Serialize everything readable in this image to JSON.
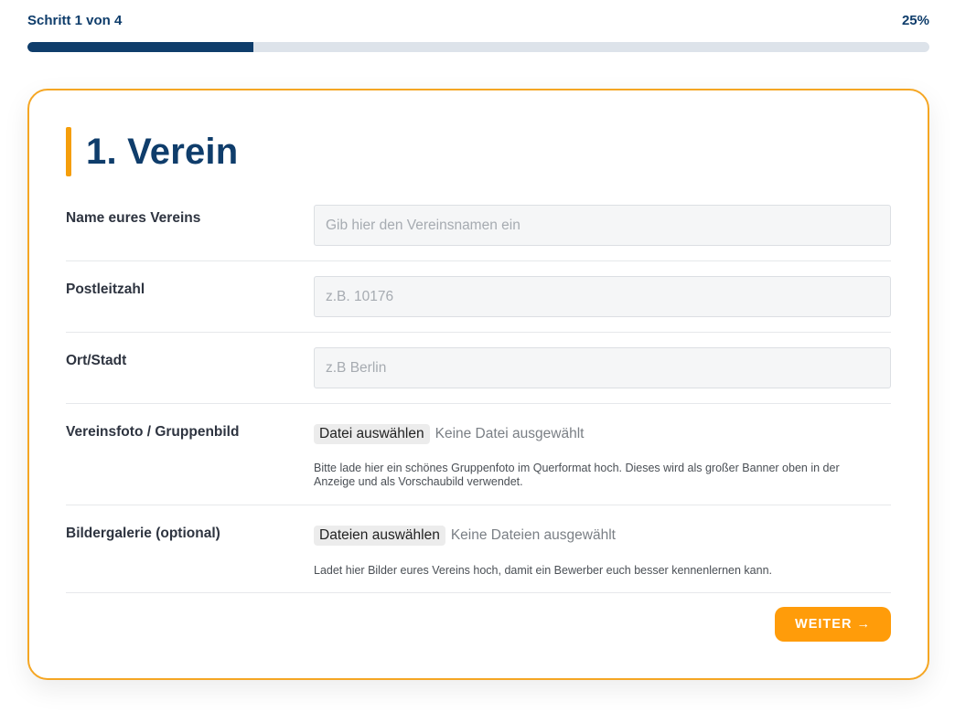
{
  "progress": {
    "step_label": "Schritt 1 von 4",
    "percent_label": "25%",
    "fraction": 0.25,
    "fill_color": "#0f3d6b",
    "track_color": "#dde3ea"
  },
  "section": {
    "title": "1. Verein",
    "accent_color": "#f59e0b",
    "border_color": "#f5a623"
  },
  "fields": {
    "name": {
      "label": "Name eures Vereins",
      "placeholder": "Gib hier den Vereinsnamen ein",
      "value": ""
    },
    "zip": {
      "label": "Postleitzahl",
      "placeholder": "z.B. 10176",
      "value": ""
    },
    "city": {
      "label": "Ort/Stadt",
      "placeholder": "z.B Berlin",
      "value": ""
    },
    "photo": {
      "label": "Vereinsfoto / Gruppenbild",
      "button": "Datei auswählen",
      "status": "Keine Datei ausgewählt",
      "help": "Bitte lade hier ein schönes Gruppenfoto im Querformat hoch. Dieses wird als großer Banner oben in der Anzeige und als Vorschaubild verwendet."
    },
    "gallery": {
      "label": "Bildergalerie (optional)",
      "button": "Dateien auswählen",
      "status": "Keine Dateien ausgewählt",
      "help": "Ladet hier Bilder eures Vereins hoch, damit ein Bewerber euch besser kennenlernen kann."
    }
  },
  "actions": {
    "next_label": "WEITER →",
    "next_color": "#ff9c0a"
  }
}
